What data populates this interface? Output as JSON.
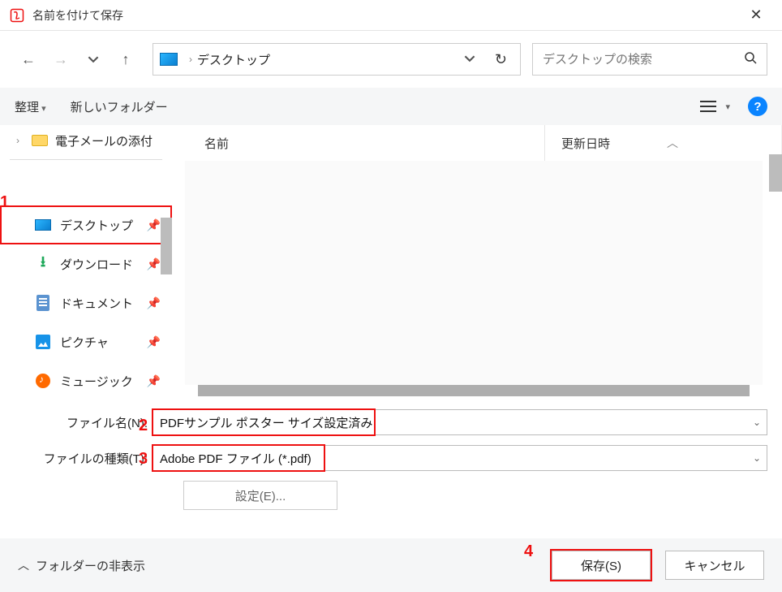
{
  "window": {
    "title": "名前を付けて保存"
  },
  "address": {
    "location": "デスクトップ"
  },
  "search": {
    "placeholder": "デスクトップの検索"
  },
  "toolbar": {
    "organize": "整理",
    "newfolder": "新しいフォルダー"
  },
  "tree": {
    "email_attach": "電子メールの添付"
  },
  "quickaccess": {
    "desktop": "デスクトップ",
    "downloads": "ダウンロード",
    "documents": "ドキュメント",
    "pictures": "ピクチャ",
    "music": "ミュージック"
  },
  "columns": {
    "name": "名前",
    "date": "更新日時"
  },
  "form": {
    "filename_label": "ファイル名(N):",
    "filename_value": "PDFサンプル ポスター サイズ設定済み",
    "filetype_label": "ファイルの種類(T):",
    "filetype_value": "Adobe PDF ファイル (*.pdf)",
    "settings_label": "設定(E)..."
  },
  "footer": {
    "hide_folders": "フォルダーの非表示",
    "save": "保存(S)",
    "cancel": "キャンセル"
  },
  "annotations": {
    "a1": "1",
    "a2": "2",
    "a3": "3",
    "a4": "4"
  }
}
